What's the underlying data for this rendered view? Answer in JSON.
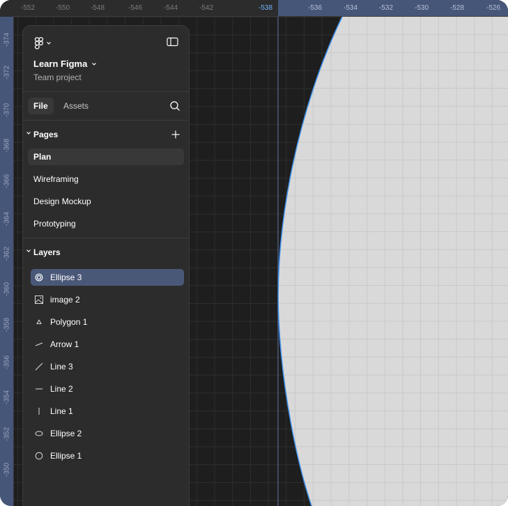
{
  "app": {
    "name": "Figma"
  },
  "file": {
    "name": "Learn Figma",
    "project": "Team project"
  },
  "tabs": [
    {
      "label": "File",
      "active": true
    },
    {
      "label": "Assets",
      "active": false
    }
  ],
  "pages": {
    "title": "Pages",
    "items": [
      {
        "label": "Plan",
        "selected": true
      },
      {
        "label": "Wireframing",
        "selected": false
      },
      {
        "label": "Design Mockup",
        "selected": false
      },
      {
        "label": "Prototyping",
        "selected": false
      }
    ]
  },
  "layers": {
    "title": "Layers",
    "items": [
      {
        "label": "Ellipse 3",
        "icon": "ellipse-target-icon",
        "selected": true
      },
      {
        "label": "image 2",
        "icon": "image-icon",
        "selected": false
      },
      {
        "label": "Polygon 1",
        "icon": "polygon-icon",
        "selected": false
      },
      {
        "label": "Arrow 1",
        "icon": "arrow-icon",
        "selected": false
      },
      {
        "label": "Line 3",
        "icon": "line-diagonal-icon",
        "selected": false
      },
      {
        "label": "Line 2",
        "icon": "line-horizontal-icon",
        "selected": false
      },
      {
        "label": "Line 1",
        "icon": "line-vertical-icon",
        "selected": false
      },
      {
        "label": "Ellipse 2",
        "icon": "ellipse-flat-icon",
        "selected": false
      },
      {
        "label": "Ellipse 1",
        "icon": "ellipse-icon",
        "selected": false
      }
    ]
  },
  "rulers": {
    "top": [
      "-552",
      "-550",
      "-548",
      "-546",
      "-544",
      "-542",
      "-538",
      "-536",
      "-534",
      "-532",
      "-530",
      "-528",
      "-526"
    ],
    "top_active": "-538",
    "left": [
      "-374",
      "-372",
      "-370",
      "-368",
      "-366",
      "-364",
      "-362",
      "-360",
      "-358",
      "-356",
      "-354",
      "-352",
      "-350"
    ]
  },
  "colors": {
    "canvas": "#1e1e1e",
    "panel": "#2c2c2c",
    "selection": "#4a5878",
    "ruler_selection": "#465679",
    "ellipse_fill": "#d9d9d9",
    "ellipse_stroke": "#3b8eea"
  }
}
